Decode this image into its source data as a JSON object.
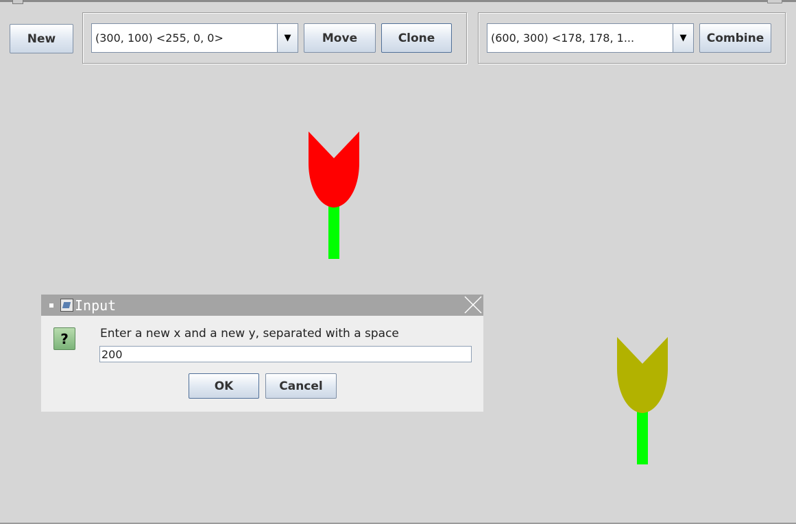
{
  "toolbar": {
    "new_label": "New",
    "shape_selector_value": "(300, 100) <255, 0, 0>",
    "move_label": "Move",
    "clone_label": "Clone",
    "combine_selector_value": "(600, 300) <178, 178, 1...",
    "combine_label": "Combine",
    "dropdown_icon": "triangle-down-icon"
  },
  "canvas": {
    "flowers": [
      {
        "name": "red-tulip",
        "petal_color": "#ff0000",
        "stem_color": "#00ff00"
      },
      {
        "name": "olive-tulip",
        "petal_color": "#b2b200",
        "stem_color": "#00ff00"
      }
    ]
  },
  "dialog": {
    "title": "Input",
    "question_icon": "?",
    "prompt": "Enter a new x and a new y, separated with a space",
    "input_value": "200",
    "ok_label": "OK",
    "cancel_label": "Cancel"
  },
  "colors": {
    "background": "#d6d6d6",
    "dialog_title_bar": "#a4a4a4",
    "dialog_body": "#eeeeee"
  }
}
